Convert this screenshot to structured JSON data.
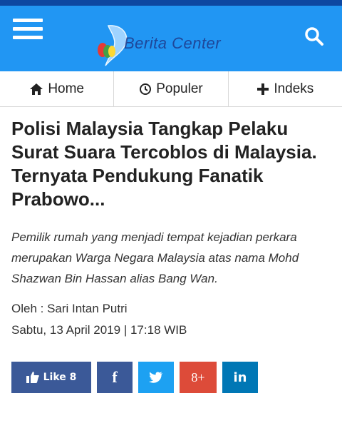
{
  "header": {
    "brand": "Berita Center",
    "menu_icon": "hamburger-icon",
    "search_icon": "search-icon",
    "bg_color": "#2196f3"
  },
  "nav": {
    "items": [
      {
        "label": "Home",
        "icon": "home-icon"
      },
      {
        "label": "Populer",
        "icon": "clock-icon"
      },
      {
        "label": "Indeks",
        "icon": "plus-icon"
      }
    ]
  },
  "article": {
    "title": "Polisi Malaysia Tangkap Pelaku Surat Suara Tercoblos di Malaysia. Ternyata Pendukung Fanatik Prabowo...",
    "summary": "Pemilik rumah yang menjadi tempat kejadian perkara merupakan Warga Negara Malaysia atas nama Mohd Shazwan Bin Hassan alias Bang Wan.",
    "author": "Oleh : Sari Intan Putri",
    "date": "Sabtu, 13 April 2019 | 17:18 WIB"
  },
  "share": {
    "like_label": "Like 8",
    "facebook_label": "f",
    "googleplus_label": "8+",
    "linkedin_label": "in",
    "colors": {
      "facebook": "#3b5998",
      "twitter": "#1da1f2",
      "googleplus": "#dd4b39",
      "linkedin": "#0077b5"
    }
  }
}
